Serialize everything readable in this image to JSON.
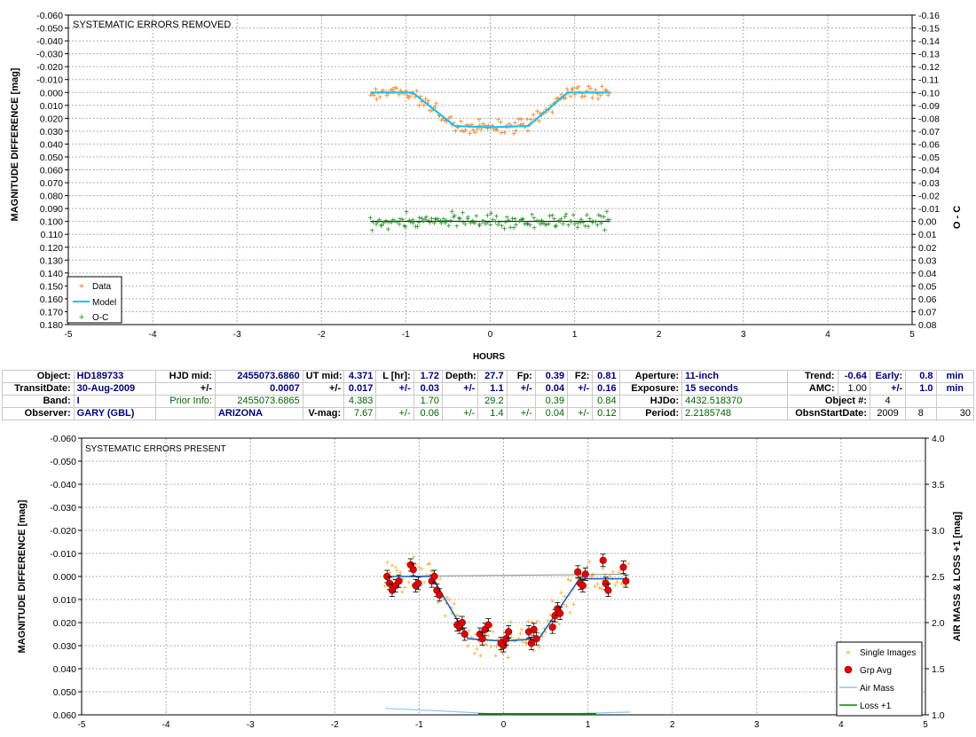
{
  "chart_data": [
    {
      "type": "scatter",
      "annotation": "SYSTEMATIC ERRORS REMOVED",
      "xlabel": "HOURS",
      "ylabel": "MAGNITUDE DIFFERENCE [mag]",
      "y2label": "O - C",
      "xlim": [
        -5,
        5
      ],
      "ylim": [
        -0.06,
        0.18
      ],
      "y_inverted": true,
      "y2lim": [
        -0.16,
        0.08
      ],
      "x_ticks": [
        "-5",
        "-4",
        "-3",
        "-2",
        "-1",
        "0",
        "1",
        "2",
        "3",
        "4",
        "5"
      ],
      "y_ticks": [
        "-0.060",
        "-0.050",
        "-0.040",
        "-0.030",
        "-0.020",
        "-0.010",
        "0.000",
        "0.010",
        "0.020",
        "0.030",
        "0.040",
        "0.050",
        "0.060",
        "0.070",
        "0.080",
        "0.090",
        "0.100",
        "0.110",
        "0.120",
        "0.130",
        "0.140",
        "0.150",
        "0.160",
        "0.170",
        "0.180"
      ],
      "y2_ticks": [
        "-0.16",
        "-0.15",
        "-0.14",
        "-0.13",
        "-0.12",
        "-0.11",
        "-0.10",
        "-0.09",
        "-0.08",
        "-0.07",
        "-0.06",
        "-0.05",
        "-0.04",
        "-0.03",
        "-0.02",
        "-0.01",
        "0.00",
        "0.01",
        "0.02",
        "0.03",
        "0.04",
        "0.05",
        "0.06",
        "0.07",
        "0.08"
      ],
      "grid": true,
      "legend_placement": "bottom-left",
      "legend": [
        {
          "name": "Data",
          "marker": "plus",
          "color": "#f07a1a"
        },
        {
          "name": "Model",
          "marker": "line",
          "color": "#1ec0e6"
        },
        {
          "name": "O-C",
          "marker": "plus",
          "color": "#1a8a1a"
        }
      ],
      "model": {
        "x": [
          -1.42,
          -0.92,
          -0.42,
          0.0,
          0.45,
          0.92,
          1.42
        ],
        "y": [
          0.0,
          0.0,
          0.026,
          0.027,
          0.026,
          0.0,
          0.0
        ]
      },
      "data_band": {
        "x_start": -1.42,
        "x_end": 1.42,
        "count": 145,
        "scatter_mag": 0.0045
      },
      "oc_band": {
        "x_start": -1.42,
        "x_end": 1.42,
        "count": 145,
        "level": 0.1,
        "scatter_mag": 0.005
      }
    },
    {
      "type": "scatter",
      "annotation": "SYSTEMATIC ERRORS PRESENT",
      "ylabel": "MAGNITUDE DIFFERENCE [mag]",
      "y2label": "AIR MASS & LOSS +1 [mag]",
      "xlim": [
        -5,
        5
      ],
      "ylim": [
        -0.06,
        0.06
      ],
      "y_inverted": true,
      "y2lim": [
        1.0,
        4.0
      ],
      "x_ticks": [
        "-5",
        "-4",
        "-3",
        "-2",
        "-1",
        "0",
        "1",
        "2",
        "3",
        "4",
        "5"
      ],
      "y_ticks": [
        "-0.060",
        "-0.050",
        "-0.040",
        "-0.030",
        "-0.020",
        "-0.010",
        "0.000",
        "0.010",
        "0.020",
        "0.030",
        "0.040",
        "0.050",
        "0.060"
      ],
      "y2_ticks": [
        "1.0",
        "1.5",
        "2.0",
        "2.5",
        "3.0",
        "3.5",
        "4.0"
      ],
      "grid": true,
      "legend_placement": "bottom-right",
      "legend": [
        {
          "name": "Single Images",
          "marker": "plus",
          "color": "#f0a020"
        },
        {
          "name": "Grp Avg",
          "marker": "dot",
          "color": "#e00000"
        },
        {
          "name": "Air Mass",
          "marker": "line",
          "color": "#88c8e8"
        },
        {
          "name": "Loss +1",
          "marker": "line",
          "color": "#108010"
        }
      ],
      "model": {
        "x": [
          -1.38,
          -0.85,
          -0.42,
          0.0,
          0.42,
          0.9,
          1.45
        ],
        "y": [
          0.0,
          0.0,
          0.027,
          0.028,
          0.027,
          0.001,
          0.001
        ]
      },
      "baseline": {
        "x": [
          -1.38,
          1.45
        ],
        "y": [
          0.0,
          -0.001
        ]
      },
      "grp_avg": {
        "x": [
          -1.38,
          -1.35,
          -1.32,
          -1.28,
          -1.24,
          -1.1,
          -1.07,
          -1.04,
          -1.01,
          -0.85,
          -0.82,
          -0.79,
          -0.76,
          -0.55,
          -0.52,
          -0.49,
          -0.46,
          -0.28,
          -0.25,
          -0.22,
          -0.18,
          -0.03,
          0.0,
          0.03,
          0.06,
          0.3,
          0.33,
          0.36,
          0.39,
          0.58,
          0.61,
          0.64,
          0.67,
          0.88,
          0.91,
          0.94,
          0.97,
          1.18,
          1.21,
          1.24,
          1.42,
          1.45
        ],
        "y": [
          0.0,
          0.003,
          0.006,
          0.004,
          0.002,
          -0.005,
          -0.003,
          0.004,
          0.003,
          0.002,
          0.0,
          0.006,
          0.008,
          0.021,
          0.022,
          0.02,
          0.025,
          0.025,
          0.027,
          0.023,
          0.021,
          0.029,
          0.03,
          0.027,
          0.024,
          0.024,
          0.029,
          0.023,
          0.027,
          0.022,
          0.017,
          0.014,
          0.016,
          -0.002,
          0.003,
          0.004,
          -0.001,
          -0.007,
          0.003,
          0.006,
          -0.004,
          0.002
        ]
      },
      "single_band": {
        "x_start": -1.42,
        "x_end": 1.48,
        "count": 150,
        "scatter_mag": 0.006
      },
      "air_mass": {
        "x": [
          -1.4,
          -0.7,
          0.0,
          0.7,
          1.5
        ],
        "y": [
          1.07,
          1.04,
          1.005,
          1.01,
          1.03
        ]
      },
      "loss": {
        "x": [
          -0.3,
          0.4,
          1.1
        ],
        "y": [
          1.0,
          1.0,
          1.0
        ]
      }
    }
  ],
  "info": {
    "r1": {
      "object_lbl": "Object:",
      "object_val": "HD189733",
      "hjdmid_lbl": "HJD mid:",
      "hjdmid_val": "2455073.6860",
      "utmid_lbl": "UT mid:",
      "utmid_val": "4.371",
      "lhr_lbl": "L [hr]:",
      "lhr_val": "1.72",
      "depth_lbl": "Depth:",
      "depth_val": "27.7",
      "fp_lbl": "Fp:",
      "fp_val": "0.39",
      "f2_lbl": "F2:",
      "f2_val": "0.81",
      "aperture_lbl": "Aperture:",
      "aperture_val": "11-inch",
      "trend_lbl": "Trend:",
      "trend_val": "-0.64",
      "early_lbl": "Early:",
      "early_val": "0.8",
      "early_unit": "min"
    },
    "r2": {
      "transitdate_lbl": "TransitDate:",
      "transitdate_val": "30-Aug-2009",
      "pm1": "+/-",
      "pm1_val": "0.0007",
      "pm2": "+/-",
      "pm2_val": "0.017",
      "pm3": "+/-",
      "pm3_val": "0.03",
      "pm4": "+/-",
      "pm4_val": "1.1",
      "pm5": "+/-",
      "pm5_val": "0.04",
      "pm6": "+/-",
      "pm6_val": "0.16",
      "exposure_lbl": "Exposure:",
      "exposure_val": "15 seconds",
      "amc_lbl": "AMC:",
      "amc_val": "1.00",
      "pm7": "+/-",
      "pm7_val": "1.0",
      "pm7_unit": "min"
    },
    "r3": {
      "band_lbl": "Band:",
      "band_val": "I",
      "prior_lbl": "Prior Info:",
      "prior_val": "2455073.6865",
      "ut_prior": "4.383",
      "l_prior": "1.70",
      "depth_prior": "29.2",
      "fp_prior": "0.39",
      "f2_prior": "0.84",
      "hjdo_lbl": "HJDo:",
      "hjdo_val": "4432.518370",
      "objnum_lbl": "Object #:",
      "objnum_val": "4"
    },
    "r4": {
      "observer_lbl": "Observer:",
      "observer_val": "GARY (GBL)",
      "location_val": "ARIZONA",
      "vmag_lbl": "V-mag:",
      "vmag_val": "7.67",
      "pm1": "+/-",
      "pm1_val": "0.06",
      "pm2": "+/-",
      "pm2_val": "1.4",
      "pm3": "+/-",
      "pm3_val": "0.04",
      "pm4": "+/-",
      "pm4_val": "0.12",
      "period_lbl": "Period:",
      "period_val": "2.2185748",
      "obsstart_lbl": "ObsnStartDate:",
      "year": "2009",
      "month": "8",
      "day": "30"
    }
  }
}
